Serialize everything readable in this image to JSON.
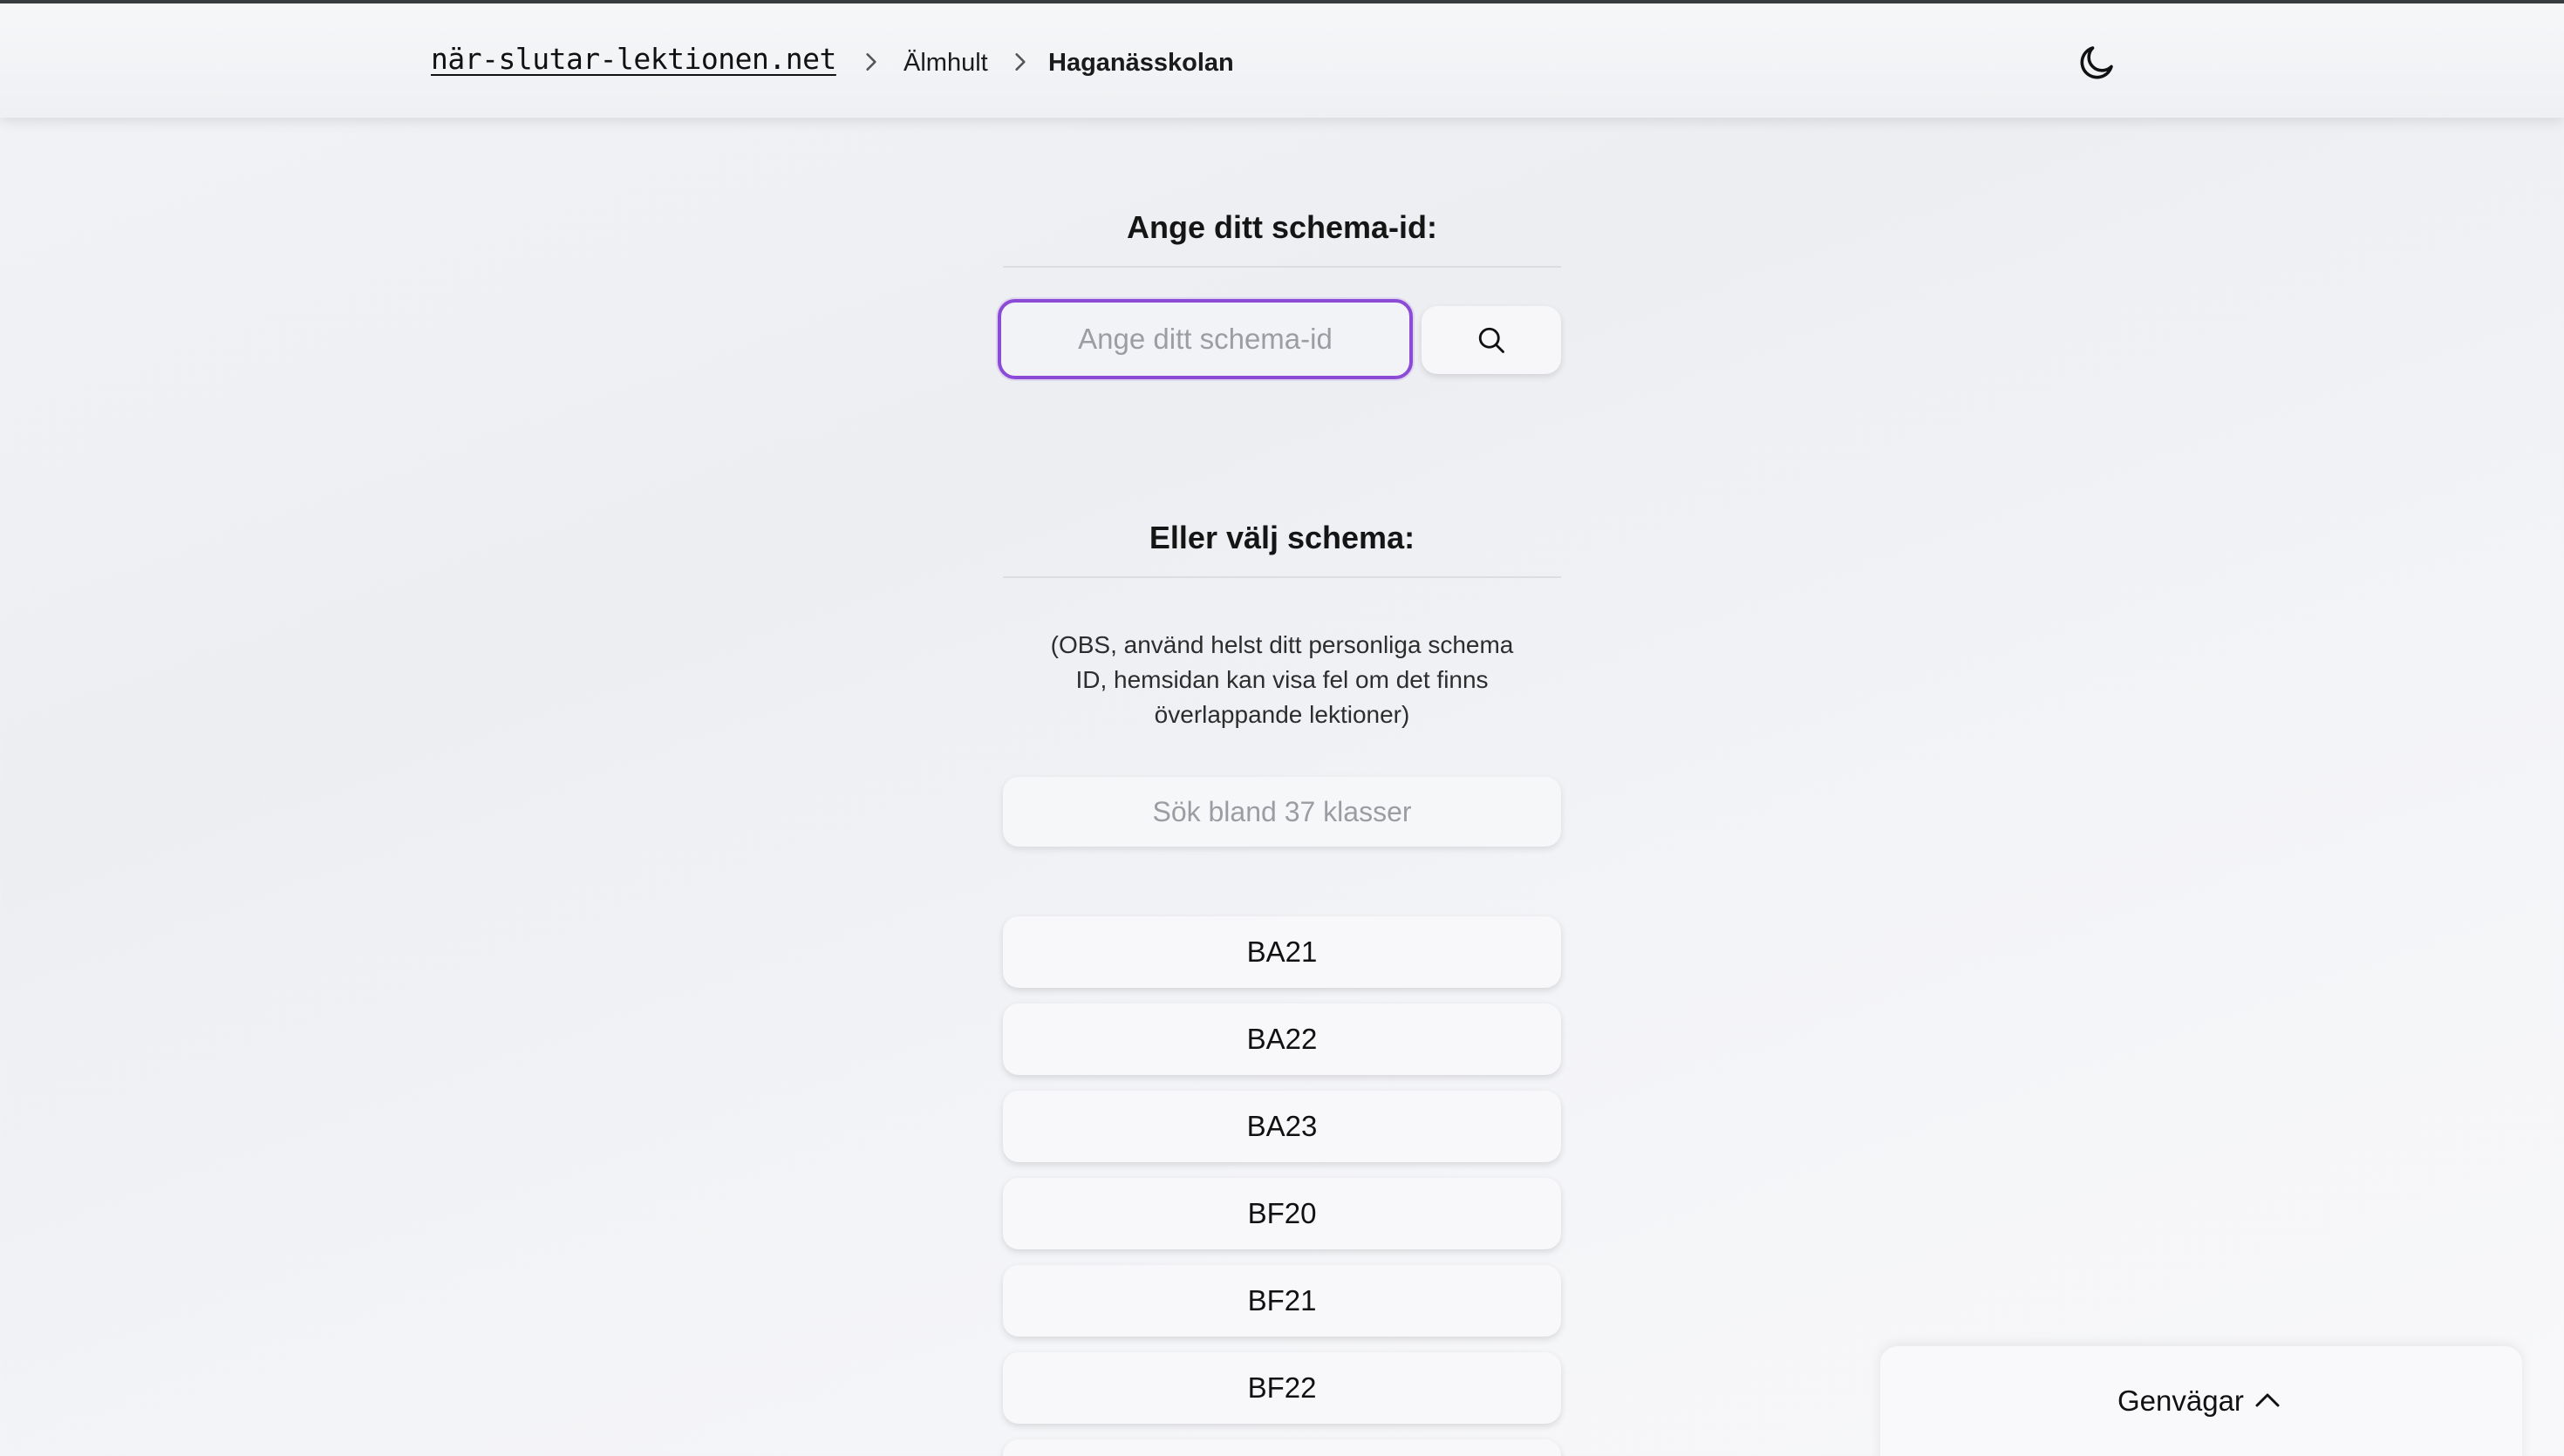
{
  "header": {
    "site_name": "när-slutar-lektionen.net",
    "breadcrumbs": [
      {
        "label": "Älmhult"
      },
      {
        "label": "Haganässkolan"
      }
    ],
    "theme_toggle_icon": "moon-icon"
  },
  "id_section": {
    "title": "Ange ditt schema-id:",
    "input_placeholder": "Ange ditt schema-id",
    "input_value": "",
    "search_icon": "search-icon"
  },
  "schedule_section": {
    "title": "Eller välj schema:",
    "note": "(OBS, använd helst ditt personliga schema ID, hemsidan kan visa fel om det finns överlappande lektioner)",
    "filter_placeholder": "Sök bland 37 klasser",
    "classes": [
      "BA21",
      "BA22",
      "BA23",
      "BF20",
      "BF21",
      "BF22"
    ]
  },
  "shortcuts": {
    "label": "Genvägar",
    "icon": "chevron-up-icon"
  },
  "colors": {
    "focus_border": "#8b4bd6",
    "text": "#111111",
    "placeholder": "#9b9da3"
  }
}
